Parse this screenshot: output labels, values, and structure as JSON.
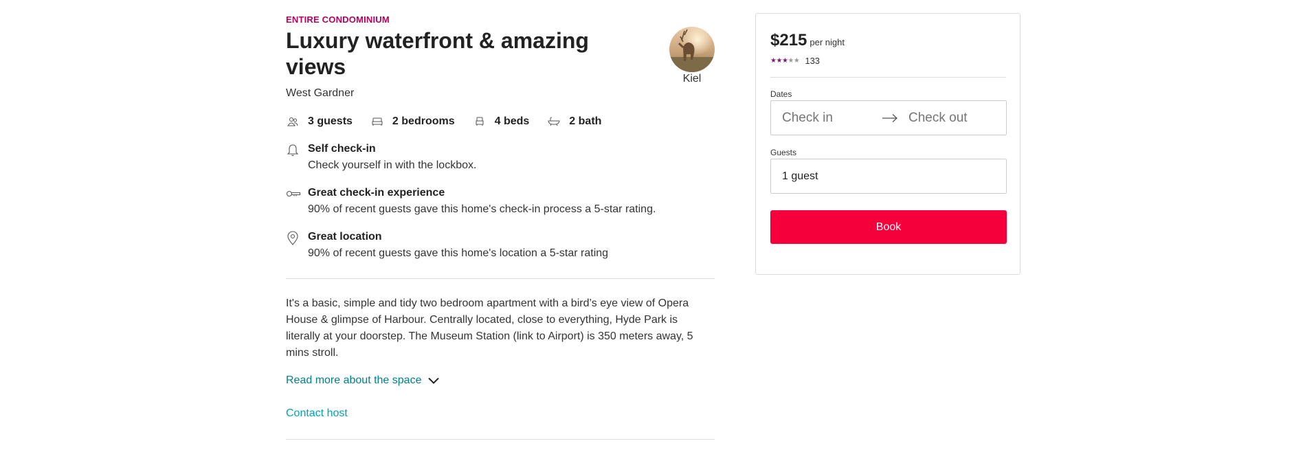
{
  "listing": {
    "type_label": "ENTIRE CONDOMINIUM",
    "title": "Luxury waterfront & amazing views",
    "location": "West Gardner",
    "host_name": "Kiel",
    "summary": [
      {
        "icon": "guests-icon",
        "text": "3 guests"
      },
      {
        "icon": "bedroom-icon",
        "text": "2 bedrooms"
      },
      {
        "icon": "bed-icon",
        "text": "4 beds"
      },
      {
        "icon": "bath-icon",
        "text": "2 bath"
      }
    ],
    "features": [
      {
        "icon": "bell-icon",
        "title": "Self check-in",
        "description": "Check yourself in with the lockbox."
      },
      {
        "icon": "key-icon",
        "title": "Great check-in experience",
        "description": "90% of recent guests gave this home's check-in process a 5-star rating."
      },
      {
        "icon": "location-pin-icon",
        "title": "Great location",
        "description": "90% of recent guests gave this home's location a 5-star rating"
      }
    ],
    "description": "It's a basic, simple and tidy two bedroom apartment with a bird’s eye view of Opera House & glimpse of Harbour. Centrally located, close to everything, Hyde Park is literally at your doorstep. The Museum Station (link to Airport) is 350 meters away, 5 mins stroll.",
    "read_more_label": "Read more about the space",
    "contact_host_label": "Contact host"
  },
  "booking": {
    "price": "$215",
    "per_night": "per night",
    "rating": 3,
    "rating_max": 5,
    "review_count": "133",
    "dates_label": "Dates",
    "check_in_placeholder": "Check in",
    "check_out_placeholder": "Check out",
    "guests_label": "Guests",
    "guests_value": "1 guest",
    "book_label": "Book"
  },
  "colors": {
    "accent": "#b8005c",
    "book_button": "#f6003c",
    "link": "#00808a",
    "contact_link": "#00a2b8",
    "star": "#7b1c72"
  }
}
